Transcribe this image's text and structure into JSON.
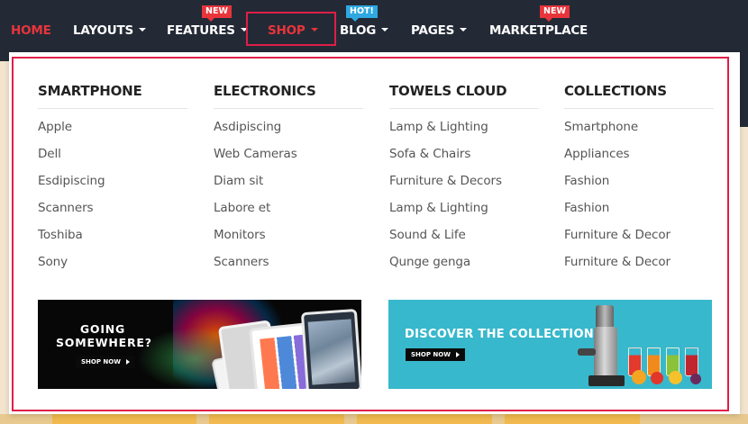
{
  "nav": {
    "items": [
      {
        "label": "HOME",
        "has_caret": false
      },
      {
        "label": "LAYOUTS",
        "has_caret": true
      },
      {
        "label": "FEATURES",
        "has_caret": true,
        "badge": "NEW"
      },
      {
        "label": "SHOP",
        "has_caret": true
      },
      {
        "label": "BLOG",
        "has_caret": true,
        "badge": "HOT!"
      },
      {
        "label": "PAGES",
        "has_caret": true
      },
      {
        "label": "MARKETPLACE",
        "has_caret": false,
        "badge": "NEW"
      }
    ],
    "active_item": "SHOP"
  },
  "mega_menu": {
    "columns": [
      {
        "title": "SMARTPHONE",
        "items": [
          "Apple",
          "Dell",
          "Esdipiscing",
          "Scanners",
          "Toshiba",
          "Sony"
        ]
      },
      {
        "title": "ELECTRONICS",
        "items": [
          "Asdipiscing",
          "Web Cameras",
          "Diam sit",
          "Labore et",
          "Monitors",
          "Scanners"
        ]
      },
      {
        "title": "TOWELS CLOUD",
        "items": [
          "Lamp & Lighting",
          "Sofa & Chairs",
          "Furniture & Decors",
          "Lamp & Lighting",
          "Sound & Life",
          "Qunge genga"
        ]
      },
      {
        "title": "COLLECTIONS",
        "items": [
          "Smartphone",
          "Appliances",
          "Fashion",
          "Fashion",
          "Furniture & Decor",
          "Furniture & Decor"
        ]
      }
    ],
    "banners": [
      {
        "headline_line1": "GOING",
        "headline_line2": "SOMEWHERE?",
        "button": "SHOP NOW"
      },
      {
        "headline": "DISCOVER THE COLLECTION",
        "button": "SHOP NOW"
      }
    ]
  },
  "colors": {
    "nav_bg": "#232a36",
    "accent_red": "#e8343b",
    "badge_blue": "#2fa8e1",
    "highlight_border": "#e01e48",
    "banner_teal": "#38b8cc"
  },
  "icons": {
    "caret": "caret-down-icon",
    "arrow": "play-arrow-icon"
  }
}
